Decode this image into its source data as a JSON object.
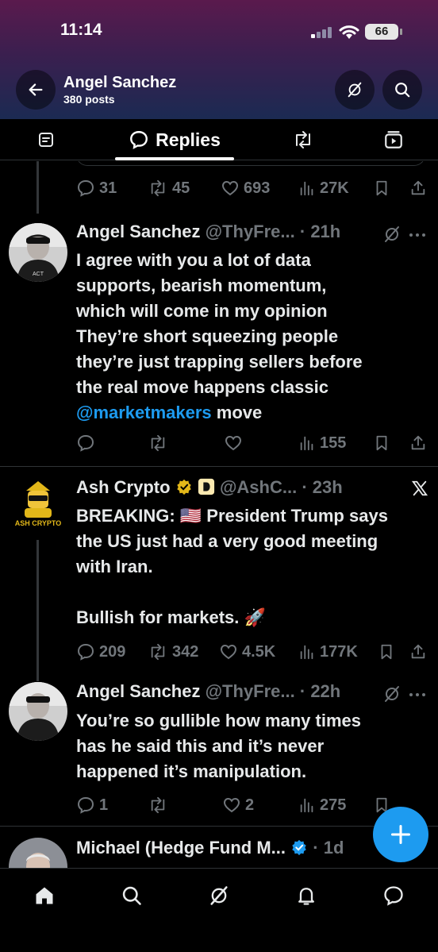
{
  "status_bar": {
    "time": "11:14",
    "battery": "66"
  },
  "profile": {
    "name": "Angel Sanchez",
    "posts": "380 posts"
  },
  "tabs": {
    "active_label": "Replies"
  },
  "top_actions": {
    "replies": "31",
    "reposts": "45",
    "likes": "693",
    "views": "27K"
  },
  "posts": [
    {
      "author": "Angel Sanchez",
      "handle": "@ThyFre...",
      "time": "· 21h",
      "text_lines": [
        "I agree with you a lot of data",
        "supports, bearish momentum,",
        "which will come in my opinion",
        "They’re short squeezing people",
        "they’re just trapping sellers before",
        "the real move happens classic"
      ],
      "mention": "@marketmakers",
      "after_mention": " move",
      "replies": "",
      "reposts": "",
      "likes": "",
      "views": "155"
    },
    {
      "author": "Ash Crypto",
      "handle": "@AshC...",
      "time": "· 23h",
      "avatar_text": "ASH CRYPTO",
      "text_lines": [
        "BREAKING: 🇺🇸 President Trump says",
        "the US just had a very good meeting",
        "with Iran."
      ],
      "text_line_2": "Bullish for markets. 🚀",
      "replies": "209",
      "reposts": "342",
      "likes": "4.5K",
      "views": "177K"
    },
    {
      "author": "Angel Sanchez",
      "handle": "@ThyFre...",
      "time": "· 22h",
      "text_lines": [
        "You’re so gullible how many times",
        "has he said this and it’s never",
        "happened it’s manipulation."
      ],
      "replies": "1",
      "reposts": "",
      "likes": "2",
      "views": "275"
    },
    {
      "author": "Michael (Hedge Fund M...",
      "time": "· 1d"
    }
  ],
  "colors": {
    "accent": "#1d9bf0",
    "muted": "#71767b",
    "verified_gold": "#e2b719"
  }
}
